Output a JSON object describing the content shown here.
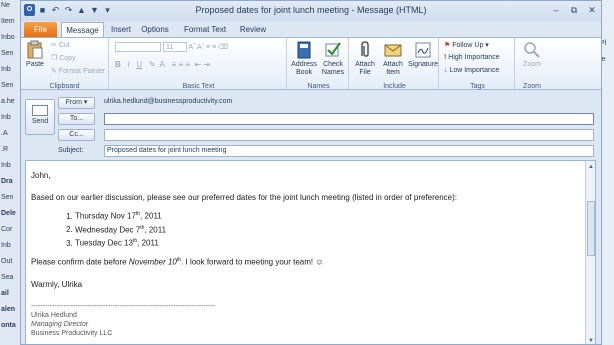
{
  "background_left": [
    "Ne",
    "Item",
    "Inbo",
    "Sen",
    "Inb",
    "Sen",
    "a.he",
    "Inb",
    ".A",
    ".R",
    "Inb",
    "Dra",
    "Sen",
    "Dele",
    "Cor",
    "Inb",
    "Out",
    "Sea",
    "ail",
    "alen",
    "onta"
  ],
  "background_right": [
    "",
    "Pl",
    "le"
  ],
  "title": "Proposed dates for joint lunch meeting  -  Message (HTML)",
  "tabs": {
    "file": "File",
    "message": "Message",
    "insert": "Insert",
    "options": "Options",
    "format": "Format Text",
    "review": "Review"
  },
  "ribbon": {
    "clipboard": {
      "label": "Clipboard",
      "paste": "Paste",
      "cut": "Cut",
      "copy": "Copy",
      "format_painter": "Format Painter"
    },
    "basic_text": {
      "label": "Basic Text",
      "font_size": "11"
    },
    "names": {
      "label": "Names",
      "address_book": "Address Book",
      "check_names": "Check Names"
    },
    "include": {
      "label": "Include",
      "attach_file": "Attach File",
      "attach_item": "Attach Item",
      "signature": "Signature"
    },
    "tags": {
      "label": "Tags",
      "follow_up": "Follow Up",
      "high_importance": "High Importance",
      "low_importance": "Low Importance"
    },
    "zoom": {
      "label": "Zoom",
      "zoom": "Zoom"
    }
  },
  "header": {
    "send": "Send",
    "from_label": "From",
    "from_value": "ulrika.hedlund@businessproductivity.com",
    "to_label": "To...",
    "to_value": "",
    "cc_label": "Cc...",
    "cc_value": "",
    "subject_label": "Subject:",
    "subject_value": "Proposed dates for joint lunch meeting"
  },
  "body": {
    "greeting": "John,",
    "intro": "Based on our earlier discussion, please see our preferred dates for the joint lunch meeting (listed in order of preference):",
    "dates": [
      {
        "pre": "Thursday Nov 17",
        "sup": "th",
        "post": ", 2011"
      },
      {
        "pre": "Wednesday Dec 7",
        "sup": "th",
        "post": ", 2011"
      },
      {
        "pre": "Tuesday Dec 13",
        "sup": "th",
        "post": ", 2011"
      }
    ],
    "confirm_pre": "Please confirm date before ",
    "confirm_date": "November 10",
    "confirm_sup": "th",
    "confirm_post": ". I look forward to meeting your team! ☺",
    "closing": "Warmly, Ulrika",
    "sig_rule": "-------------------------------------------------------------------------------",
    "sig_name": "Ulrika Hedlund",
    "sig_title": "Managing Director",
    "sig_company": "Business Productivity LLC"
  },
  "icons": {
    "app": "outlook-icon",
    "save": "save-icon",
    "undo": "undo-icon",
    "redo": "redo-icon",
    "help": "help-icon"
  },
  "colors": {
    "file_tab": "#e56e12",
    "ribbon_bg": "#e4edf8",
    "window_bg": "#dde7f3",
    "high_importance": "#c0392b",
    "low_importance": "#2c64b0",
    "follow_up": "#c0392b"
  }
}
